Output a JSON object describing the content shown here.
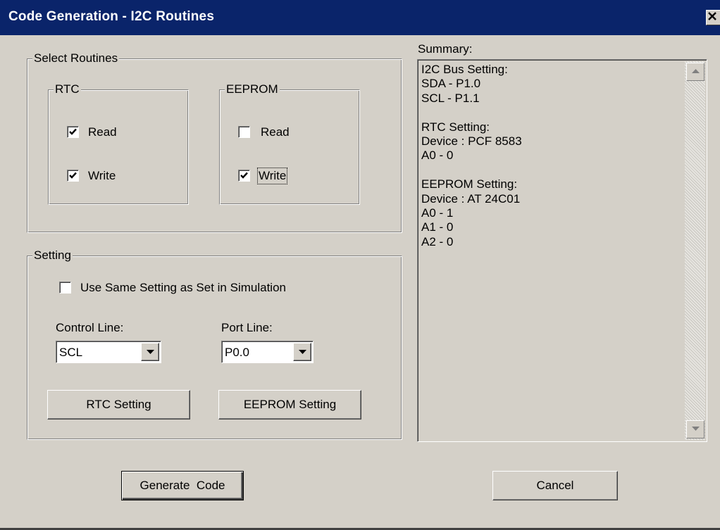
{
  "window": {
    "title": "Code Generation - I2C Routines",
    "close_glyph": "✕"
  },
  "select_routines": {
    "title": "Select Routines",
    "rtc": {
      "title": "RTC",
      "read": {
        "label": "Read",
        "checked": true
      },
      "write": {
        "label": "Write",
        "checked": true
      }
    },
    "eeprom": {
      "title": "EEPROM",
      "read": {
        "label": "Read",
        "checked": false
      },
      "write": {
        "label": "Write",
        "checked": true
      }
    }
  },
  "setting": {
    "title": "Setting",
    "use_same": {
      "label": "Use Same Setting as Set in Simulation",
      "checked": false
    },
    "control_line": {
      "label": "Control Line:",
      "value": "SCL"
    },
    "port_line": {
      "label": "Port Line:",
      "value": "P0.0"
    },
    "rtc_setting_button": "RTC Setting",
    "eeprom_setting_button": "EEPROM Setting"
  },
  "summary": {
    "label": "Summary:",
    "text": "I2C Bus Setting:\nSDA - P1.0\nSCL - P1.1\n\nRTC Setting:\nDevice : PCF 8583\nA0 - 0\n\nEEPROM Setting:\nDevice : AT 24C01\nA0 - 1\nA1 - 0\nA2 - 0"
  },
  "buttons": {
    "generate": "Generate  Code",
    "cancel": "Cancel"
  },
  "colors": {
    "titlebar": "#0a246a",
    "face": "#d4d0c8"
  },
  "icons": {
    "check": "check-icon",
    "dropdown": "chevron-down-icon",
    "scroll_up": "scroll-up-arrow-icon",
    "scroll_down": "scroll-down-arrow-icon",
    "close": "close-icon"
  }
}
